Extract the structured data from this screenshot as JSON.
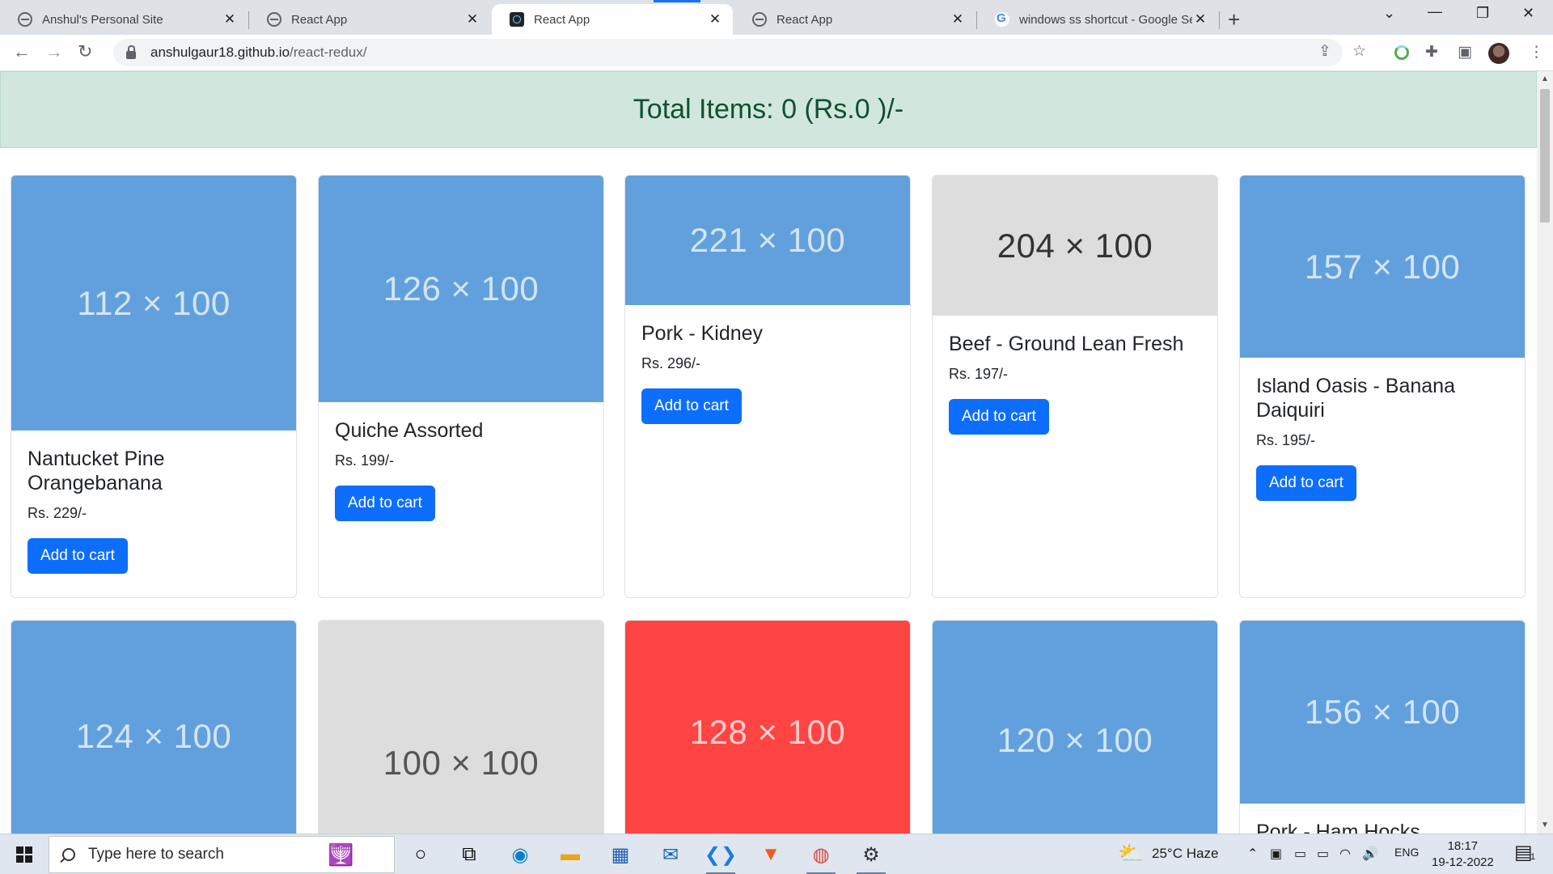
{
  "browser": {
    "tabs": [
      {
        "label": "Anshul's Personal Site",
        "favicon": "globe-icon"
      },
      {
        "label": "React App",
        "favicon": "globe-icon"
      },
      {
        "label": "React App",
        "favicon": "react-icon"
      },
      {
        "label": "React App",
        "favicon": "globe-icon"
      },
      {
        "label": "windows ss shortcut - Google Se",
        "favicon": "google-icon"
      }
    ],
    "active_tab": 2,
    "url_domain": "anshulgaur18.github.io",
    "url_path": "/react-redux/"
  },
  "page": {
    "banner": "Total Items: 0 (Rs.0 )/-",
    "accent_color": "#0d6efd",
    "banner_color": "#d1e7dd",
    "products": [
      {
        "image_label": "112 × 100",
        "image_color": "#62a0dd",
        "title": "Nantucket Pine Orangebanana",
        "price": "Rs. 229/-",
        "button": "Add to cart"
      },
      {
        "image_label": "126 × 100",
        "image_color": "#62a0dd",
        "title": "Quiche Assorted",
        "price": "Rs. 199/-",
        "button": "Add to cart"
      },
      {
        "image_label": "221 × 100",
        "image_color": "#62a0dd",
        "title": "Pork - Kidney",
        "price": "Rs. 296/-",
        "button": "Add to cart"
      },
      {
        "image_label": "204 × 100",
        "image_color": "#dddddd",
        "title": "Beef - Ground Lean Fresh",
        "price": "Rs. 197/-",
        "button": "Add to cart"
      },
      {
        "image_label": "157 × 100",
        "image_color": "#62a0dd",
        "title": "Island Oasis - Banana Daiquiri",
        "price": "Rs. 195/-",
        "button": "Add to cart"
      },
      {
        "image_label": "124 × 100",
        "image_color": "#62a0dd"
      },
      {
        "image_label": "100 × 100",
        "image_color": "#dddddd"
      },
      {
        "image_label": "128 × 100",
        "image_color": "#ff4444"
      },
      {
        "image_label": "120 × 100",
        "image_color": "#62a0dd"
      },
      {
        "image_label": "156 × 100",
        "image_color": "#62a0dd",
        "title": "Pork - Ham Hocks"
      }
    ]
  },
  "taskbar": {
    "search_placeholder": "Type here to search",
    "weather": "25°C  Haze",
    "language": "ENG",
    "time": "18:17",
    "date": "19-12-2022",
    "notifications": "1"
  }
}
